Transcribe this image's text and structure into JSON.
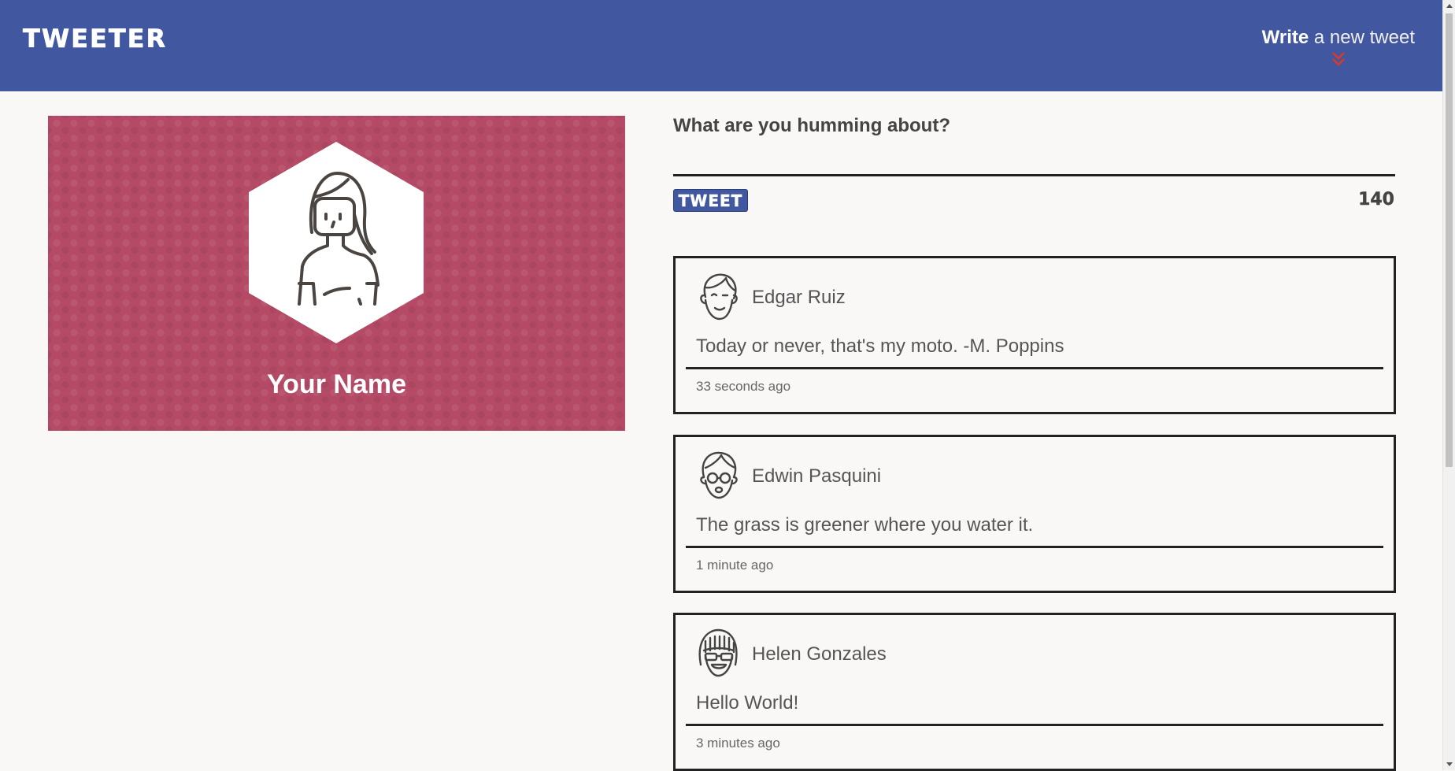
{
  "header": {
    "brand": "TWEETER",
    "compose_link_strong": "Write",
    "compose_link_rest": " a new tweet"
  },
  "profile": {
    "name": "Your Name"
  },
  "compose": {
    "prompt": "What are you humming about?",
    "text_value": "",
    "button_label": "TWEET",
    "char_count": "140"
  },
  "tweets": [
    {
      "author": "Edgar Ruiz",
      "content": "Today or never, that's my moto. -M. Poppins",
      "time": "33 seconds ago",
      "avatar_icon": "boy-avatar-icon"
    },
    {
      "author": "Edwin Pasquini",
      "content": "The grass is greener where you water it.",
      "time": "1 minute ago",
      "avatar_icon": "glasses-avatar-icon"
    },
    {
      "author": "Helen Gonzales",
      "content": "Hello World!",
      "time": "3 minutes ago",
      "avatar_icon": "sunglasses-avatar-icon"
    }
  ],
  "colors": {
    "header_bg": "#4158a0",
    "profile_bg": "#b44a66",
    "page_bg": "#f9f8f6",
    "chevron": "#d93a2b"
  }
}
